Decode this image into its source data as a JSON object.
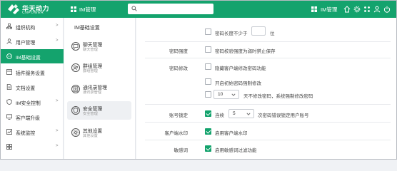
{
  "header": {
    "brand": "华天动力",
    "brand_sub": "CNPOWER",
    "title": "IM管理",
    "search_value": "",
    "search_placeholder": "",
    "right_label": "IM管理",
    "accent": "#14a36d"
  },
  "sidebar": {
    "items": [
      {
        "label": "组织机构",
        "chevron": ">"
      },
      {
        "label": "用户管理",
        "chevron": ">"
      },
      {
        "label": "IM基础设置",
        "chevron": ""
      },
      {
        "label": "插件服务设置",
        "chevron": ""
      },
      {
        "label": "文档设置",
        "chevron": ""
      },
      {
        "label": "IM安全控制",
        "chevron": ">"
      },
      {
        "label": "客户端升级",
        "chevron": ""
      },
      {
        "label": "系统监控",
        "chevron": ">"
      },
      {
        "label": "",
        "chevron": ">"
      }
    ]
  },
  "subnav": {
    "title": "IM基础设置",
    "items": [
      {
        "title": "聊天管理",
        "sub": "聊天管理"
      },
      {
        "title": "群组管理",
        "sub": "群组管理"
      },
      {
        "title": "通讯录管理",
        "sub": "通讯录管理"
      },
      {
        "title": "安全管理",
        "sub": "安全管理"
      },
      {
        "title": "其他设置",
        "sub": "其他设置"
      }
    ]
  },
  "settings": {
    "min_length_text": "密码长度不少于",
    "min_length_value": "",
    "min_length_unit": "位",
    "pw_strength_label": "密码强度",
    "pw_strength_text": "密码校验强度为弱时禁止保存",
    "pw_change_label": "密码修改",
    "pw_change_hide_text": "隐藏客户端修改密码功能",
    "pw_change_init_text": "开启初始密码强制修改",
    "pw_expire_days": "10",
    "pw_expire_text": "天不修改密码，系统强制修改密码",
    "lock_label": "账号锁定",
    "lock_prefix": "连续",
    "lock_count": "5",
    "lock_text": "次密码错误锁定用户账号",
    "watermark_label": "客户端水印",
    "watermark_text": "启用客户端水印",
    "sensitive_label": "敏感词",
    "sensitive_text": "启用敏感词过滤功能"
  }
}
